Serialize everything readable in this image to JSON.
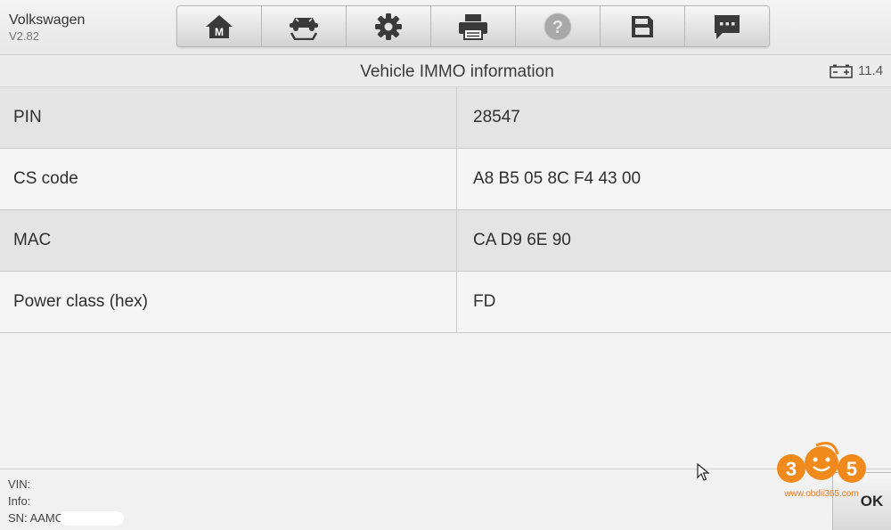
{
  "app": {
    "name": "Volkswagen",
    "version": "V2.82"
  },
  "toolbar": {
    "buttons": [
      {
        "name": "home",
        "icon": "home-icon",
        "label": "M"
      },
      {
        "name": "vehicle-swap",
        "icon": "vehicle-swap-icon"
      },
      {
        "name": "settings",
        "icon": "gear-icon"
      },
      {
        "name": "print",
        "icon": "printer-icon"
      },
      {
        "name": "help",
        "icon": "help-icon",
        "disabled": true
      },
      {
        "name": "save",
        "icon": "save-icon"
      },
      {
        "name": "feedback",
        "icon": "message-icon"
      }
    ]
  },
  "titlebar": {
    "title": "Vehicle IMMO information",
    "battery_icon": "battery-icon",
    "battery_value": "11.4"
  },
  "table": {
    "rows": [
      {
        "label": "PIN",
        "value": "28547"
      },
      {
        "label": "CS code",
        "value": "A8 B5 05 8C F4 43 00"
      },
      {
        "label": "MAC",
        "value": "CA D9 6E 90"
      },
      {
        "label": "Power class (hex)",
        "value": "FD"
      }
    ]
  },
  "footer": {
    "vin": "VIN:",
    "info": "Info:",
    "sn": "SN: AAMC"
  },
  "ok_label": "OK",
  "watermark": {
    "digits": "365",
    "url": "www.obdii365.com"
  },
  "colors": {
    "icon_dark": "#3a3a3a",
    "icon_disabled": "#a8a8a8",
    "watermark_orange": "#f08a1c"
  }
}
